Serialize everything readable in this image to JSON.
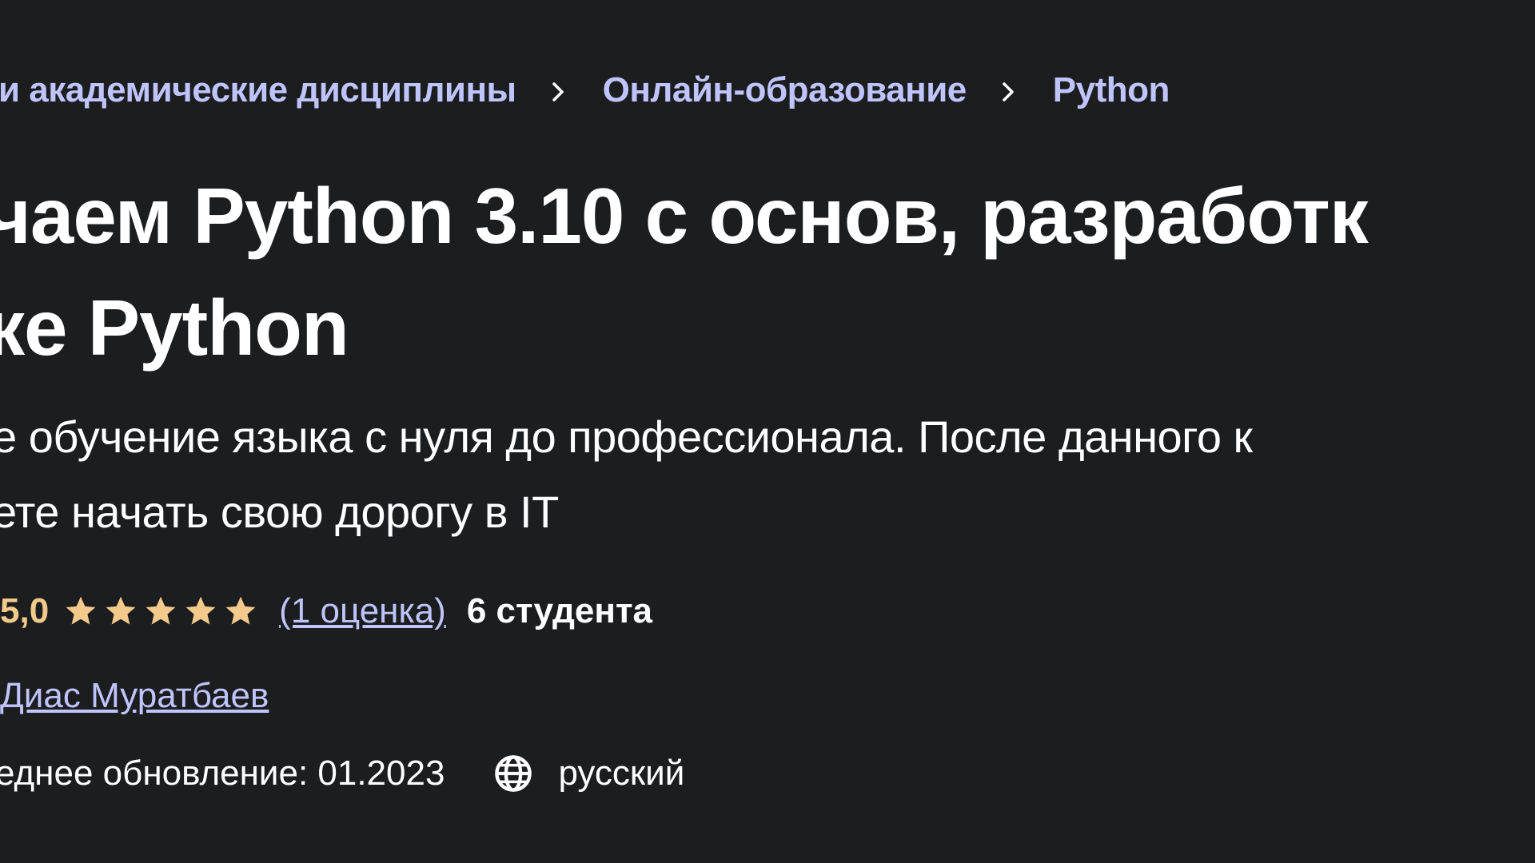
{
  "breadcrumb": {
    "items": [
      {
        "label": "и академические дисциплины"
      },
      {
        "label": "Онлайн-образование"
      },
      {
        "label": "Python"
      }
    ],
    "separator_icon": "chevron-right-icon"
  },
  "course": {
    "title_lines": [
      "чаем Python 3.10 с основ, разработк",
      "ке Python"
    ],
    "subtitle_lines": [
      "е обучение языка с нуля до профессионала. После данного к",
      "ете начать свою дорогу в IT"
    ]
  },
  "rating": {
    "value": "5,0",
    "stars": 5,
    "star_color": "#f3ca8c",
    "count_label": "(1 оценка)",
    "students_label": "6 студента"
  },
  "author": {
    "name": "Диас Муратбаев"
  },
  "meta": {
    "last_updated": "еднее обновление: 01.2023",
    "language_icon": "globe-icon",
    "language": "русский"
  },
  "colors": {
    "background": "#1c1d1f",
    "link": "#c0c4fc",
    "rating": "#f3ca8c",
    "text": "#ffffff"
  }
}
